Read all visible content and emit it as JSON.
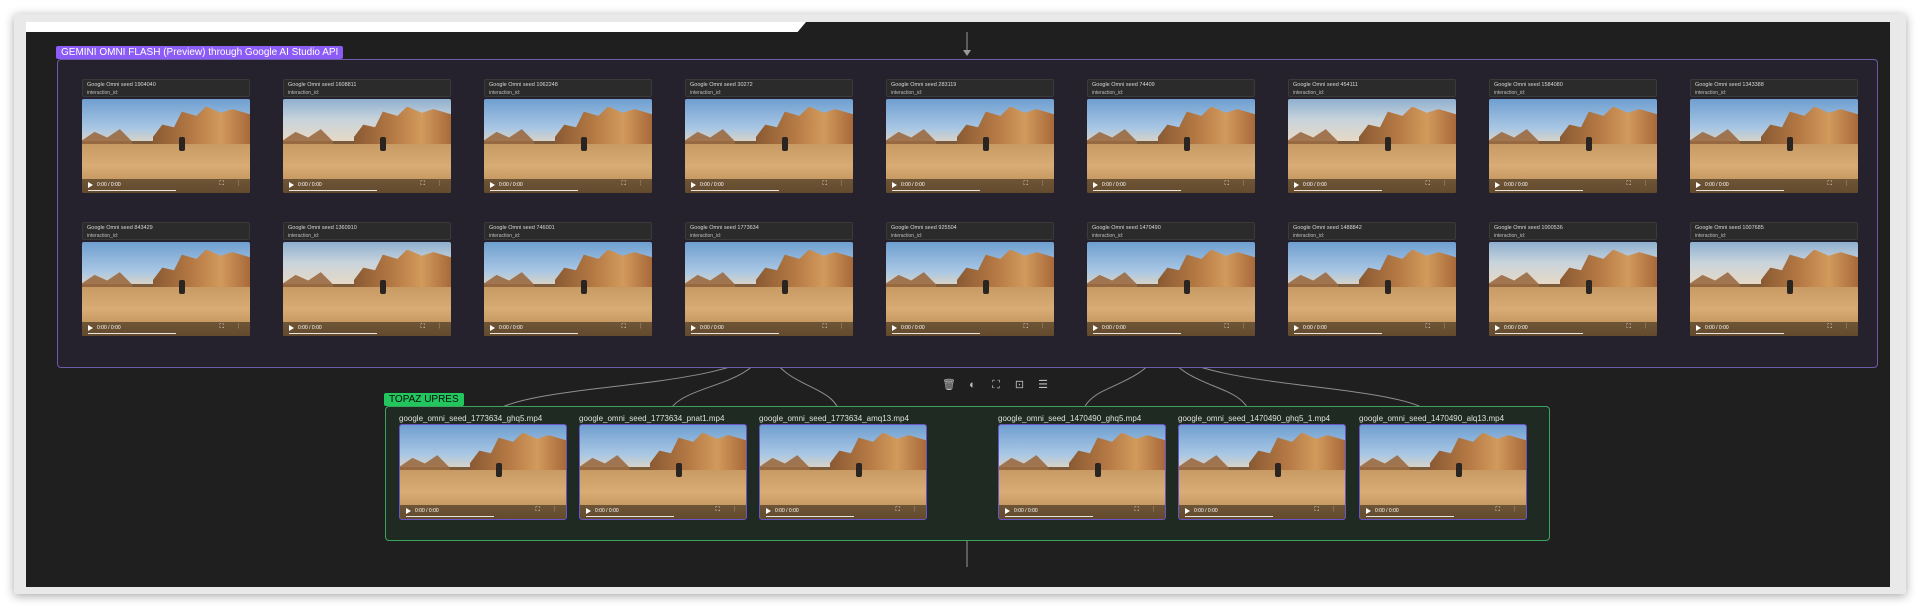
{
  "groups": {
    "gemini": {
      "label": "GEMINI OMNI FLASH (Preview) through Google AI Studio API",
      "color": "#8b5cf6"
    },
    "topaz": {
      "label": "TOPAZ UPRES",
      "color": "#22c55e"
    }
  },
  "video_player": {
    "time": "0:00 / 0:00",
    "icons": "⛶ ⋮"
  },
  "gemini_cards": [
    {
      "title": "Google Omni seed 1904040",
      "sub": "interaction_id:"
    },
    {
      "title": "Google Omni seed 1608811",
      "sub": "interaction_id:"
    },
    {
      "title": "Google Omni seed 1062248",
      "sub": "interaction_id:"
    },
    {
      "title": "Google Omni seed 30272",
      "sub": "interaction_id:"
    },
    {
      "title": "Google Omni seed 283119",
      "sub": "interaction_id:"
    },
    {
      "title": "Google Omni seed 74409",
      "sub": "interaction_id:"
    },
    {
      "title": "Google Omni seed 454111",
      "sub": "interaction_id:"
    },
    {
      "title": "Google Omni seed 1584080",
      "sub": "interaction_id:"
    },
    {
      "title": "Google Omni seed 1343388",
      "sub": "interaction_id:"
    },
    {
      "title": "Google Omni seed 843429",
      "sub": "interaction_id:"
    },
    {
      "title": "Google Omni seed 1360910",
      "sub": "interaction_id:"
    },
    {
      "title": "Google Omni seed 746001",
      "sub": "interaction_id:"
    },
    {
      "title": "Google Omni seed 1773634",
      "sub": "interaction_id:"
    },
    {
      "title": "Google Omni seed 925504",
      "sub": "interaction_id:"
    },
    {
      "title": "Google Omni seed 1470490",
      "sub": "interaction_id:"
    },
    {
      "title": "Google Omni seed 1488842",
      "sub": "interaction_id:"
    },
    {
      "title": "Google Omni seed 1000536",
      "sub": "interaction_id:"
    },
    {
      "title": "Google Omni seed 1007685",
      "sub": "interaction_id:"
    }
  ],
  "topaz_cards": [
    {
      "title": "google_omni_seed_1773634_ghq5.mp4"
    },
    {
      "title": "google_omni_seed_1773634_pnat1.mp4"
    },
    {
      "title": "google_omni_seed_1773634_amq13.mp4"
    },
    {
      "title": "google_omni_seed_1470490_ghq5.mp4"
    },
    {
      "title": "google_omni_seed_1470490_ghq5_1.mp4"
    },
    {
      "title": "google_omni_seed_1470490_alq13.mp4"
    }
  ],
  "toolbar": {
    "delete_icon": "🗑",
    "color_icon": "◐",
    "fit_icon": "⛶",
    "frame_icon": "⊡",
    "align_icon": "☰"
  }
}
